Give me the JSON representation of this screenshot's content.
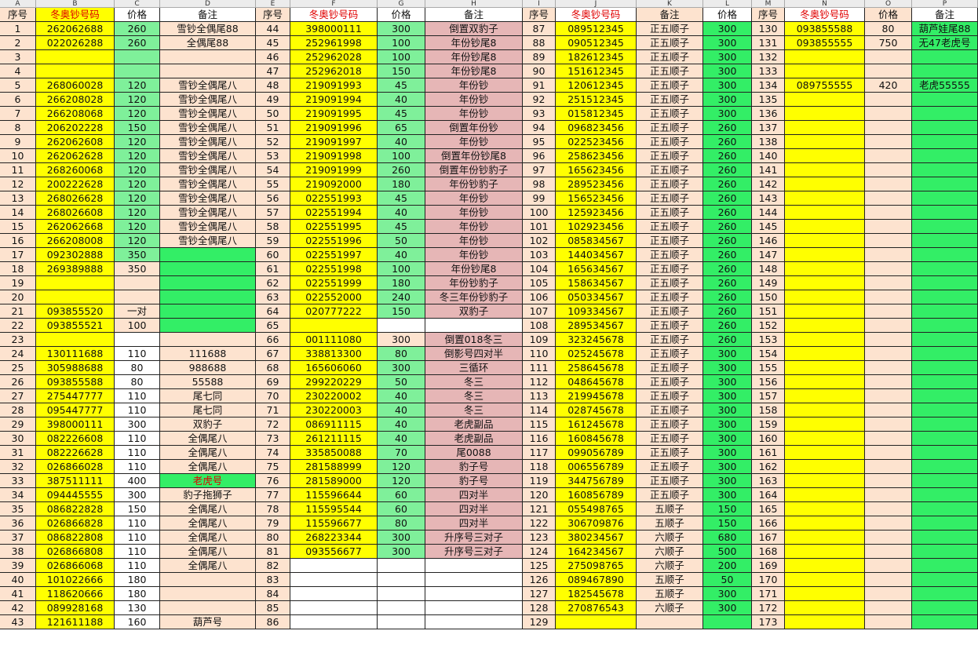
{
  "colors": {
    "yellow": "#ffff00",
    "pink": "#fde3cf",
    "green": "#33ee66",
    "green2": "#7ff09a",
    "rose": "#e6b6b6",
    "white": "#ffffff",
    "header_bg": "#ececec",
    "red_text": "#e00000"
  },
  "col_letters": [
    "A",
    "B",
    "C",
    "D",
    "E",
    "F",
    "G",
    "H",
    "I",
    "J",
    "K",
    "L",
    "M",
    "N",
    "O",
    "P"
  ],
  "header_row": [
    "序号",
    "冬奥钞号码",
    "价格",
    "备注",
    "序号",
    "冬奥钞号码",
    "价格",
    "备注",
    "序号",
    "冬奥钞号码",
    "备注",
    "价格",
    "序号",
    "冬奥钞号码",
    "价格",
    "备注"
  ],
  "rows": [
    [
      "1",
      "262062688",
      "260",
      "雪钞全偶尾88",
      "44",
      "398000111",
      "300",
      "倒置双豹子",
      "87",
      "089512345",
      "正五顺子",
      "300",
      "130",
      "093855588",
      "80",
      "葫芦娃尾88"
    ],
    [
      "2",
      "022026288",
      "260",
      "全偶尾88",
      "45",
      "252961998",
      "100",
      "年份钞尾8",
      "88",
      "090512345",
      "正五顺子",
      "300",
      "131",
      "093855555",
      "750",
      "无47老虎号"
    ],
    [
      "3",
      "",
      "",
      "",
      "46",
      "252962028",
      "100",
      "年份钞尾8",
      "89",
      "182612345",
      "正五顺子",
      "300",
      "132",
      "",
      "",
      ""
    ],
    [
      "4",
      "",
      "",
      "",
      "47",
      "252962018",
      "150",
      "年份钞尾8",
      "90",
      "151612345",
      "正五顺子",
      "300",
      "133",
      "",
      "",
      ""
    ],
    [
      "5",
      "268060028",
      "120",
      "雪钞全偶尾八",
      "48",
      "219091993",
      "45",
      "年份钞",
      "91",
      "120612345",
      "正五顺子",
      "300",
      "134",
      "089755555",
      "420",
      "老虎55555"
    ],
    [
      "6",
      "266208028",
      "120",
      "雪钞全偶尾八",
      "49",
      "219091994",
      "40",
      "年份钞",
      "92",
      "251512345",
      "正五顺子",
      "300",
      "135",
      "",
      "",
      ""
    ],
    [
      "7",
      "266208068",
      "120",
      "雪钞全偶尾八",
      "50",
      "219091995",
      "45",
      "年份钞",
      "93",
      "015812345",
      "正五顺子",
      "300",
      "136",
      "",
      "",
      ""
    ],
    [
      "8",
      "206202228",
      "150",
      "雪钞全偶尾八",
      "51",
      "219091996",
      "65",
      "倒置年份钞",
      "94",
      "096823456",
      "正五顺子",
      "260",
      "137",
      "",
      "",
      ""
    ],
    [
      "9",
      "262062608",
      "120",
      "雪钞全偶尾八",
      "52",
      "219091997",
      "40",
      "年份钞",
      "95",
      "022523456",
      "正五顺子",
      "260",
      "138",
      "",
      "",
      ""
    ],
    [
      "10",
      "262062628",
      "120",
      "雪钞全偶尾八",
      "53",
      "219091998",
      "100",
      "倒置年份钞尾8",
      "96",
      "258623456",
      "正五顺子",
      "260",
      "140",
      "",
      "",
      ""
    ],
    [
      "11",
      "268260068",
      "120",
      "雪钞全偶尾八",
      "54",
      "219091999",
      "260",
      "倒置年份钞豹子",
      "97",
      "165623456",
      "正五顺子",
      "260",
      "141",
      "",
      "",
      ""
    ],
    [
      "12",
      "200222628",
      "120",
      "雪钞全偶尾八",
      "55",
      "219092000",
      "180",
      "年份钞豹子",
      "98",
      "289523456",
      "正五顺子",
      "260",
      "142",
      "",
      "",
      ""
    ],
    [
      "13",
      "268026628",
      "120",
      "雪钞全偶尾八",
      "56",
      "022551993",
      "45",
      "年份钞",
      "99",
      "156523456",
      "正五顺子",
      "260",
      "143",
      "",
      "",
      ""
    ],
    [
      "14",
      "268026608",
      "120",
      "雪钞全偶尾八",
      "57",
      "022551994",
      "40",
      "年份钞",
      "100",
      "125923456",
      "正五顺子",
      "260",
      "144",
      "",
      "",
      ""
    ],
    [
      "15",
      "262062668",
      "120",
      "雪钞全偶尾八",
      "58",
      "022551995",
      "45",
      "年份钞",
      "101",
      "102923456",
      "正五顺子",
      "260",
      "145",
      "",
      "",
      ""
    ],
    [
      "16",
      "266208008",
      "120",
      "雪钞全偶尾八",
      "59",
      "022551996",
      "50",
      "年份钞",
      "102",
      "085834567",
      "正五顺子",
      "260",
      "146",
      "",
      "",
      ""
    ],
    [
      "17",
      "092302888",
      "350",
      "",
      "60",
      "022551997",
      "40",
      "年份钞",
      "103",
      "144034567",
      "正五顺子",
      "260",
      "147",
      "",
      "",
      ""
    ],
    [
      "18",
      "269389888",
      "350",
      "",
      "61",
      "022551998",
      "100",
      "年份钞尾8",
      "104",
      "165634567",
      "正五顺子",
      "260",
      "148",
      "",
      "",
      ""
    ],
    [
      "19",
      "",
      "",
      "",
      "62",
      "022551999",
      "180",
      "年份钞豹子",
      "105",
      "158634567",
      "正五顺子",
      "260",
      "149",
      "",
      "",
      ""
    ],
    [
      "20",
      "",
      "",
      "",
      "63",
      "022552000",
      "240",
      "冬三年份钞豹子",
      "106",
      "050334567",
      "正五顺子",
      "260",
      "150",
      "",
      "",
      ""
    ],
    [
      "21",
      "093855520",
      "一对",
      "",
      "64",
      "020777222",
      "150",
      "双豹子",
      "107",
      "109334567",
      "正五顺子",
      "260",
      "151",
      "",
      "",
      ""
    ],
    [
      "22",
      "093855521",
      "100",
      "",
      "65",
      "",
      "",
      "",
      "108",
      "289534567",
      "正五顺子",
      "260",
      "152",
      "",
      "",
      ""
    ],
    [
      "23",
      "",
      "",
      "",
      "66",
      "001111080",
      "300",
      "倒置018冬三",
      "109",
      "323245678",
      "正五顺子",
      "260",
      "153",
      "",
      "",
      ""
    ],
    [
      "24",
      "130111688",
      "110",
      "111688",
      "67",
      "338813300",
      "80",
      "倒影号四对半",
      "110",
      "025245678",
      "正五顺子",
      "300",
      "154",
      "",
      "",
      ""
    ],
    [
      "25",
      "305988688",
      "80",
      "988688",
      "68",
      "165606060",
      "300",
      "三循环",
      "111",
      "258645678",
      "正五顺子",
      "300",
      "155",
      "",
      "",
      ""
    ],
    [
      "26",
      "093855588",
      "80",
      "55588",
      "69",
      "299220229",
      "50",
      "冬三",
      "112",
      "048645678",
      "正五顺子",
      "300",
      "156",
      "",
      "",
      ""
    ],
    [
      "27",
      "275447777",
      "110",
      "尾七同",
      "70",
      "230220002",
      "40",
      "冬三",
      "113",
      "219945678",
      "正五顺子",
      "300",
      "157",
      "",
      "",
      ""
    ],
    [
      "28",
      "095447777",
      "110",
      "尾七同",
      "71",
      "230220003",
      "40",
      "冬三",
      "114",
      "028745678",
      "正五顺子",
      "300",
      "158",
      "",
      "",
      ""
    ],
    [
      "29",
      "398000111",
      "300",
      "双豹子",
      "72",
      "086911115",
      "40",
      "老虎副品",
      "115",
      "161245678",
      "正五顺子",
      "300",
      "159",
      "",
      "",
      ""
    ],
    [
      "30",
      "082226608",
      "110",
      "全偶尾八",
      "73",
      "261211115",
      "40",
      "老虎副品",
      "116",
      "160845678",
      "正五顺子",
      "300",
      "160",
      "",
      "",
      ""
    ],
    [
      "31",
      "082226628",
      "110",
      "全偶尾八",
      "74",
      "335850088",
      "70",
      "尾0088",
      "117",
      "099056789",
      "正五顺子",
      "300",
      "161",
      "",
      "",
      ""
    ],
    [
      "32",
      "026866028",
      "110",
      "全偶尾八",
      "75",
      "281588999",
      "120",
      "豹子号",
      "118",
      "006556789",
      "正五顺子",
      "300",
      "162",
      "",
      "",
      ""
    ],
    [
      "33",
      "387511111",
      "400",
      "老虎号",
      "76",
      "281589000",
      "120",
      "豹子号",
      "119",
      "344756789",
      "正五顺子",
      "300",
      "163",
      "",
      "",
      ""
    ],
    [
      "34",
      "094445555",
      "300",
      "豹子拖狮子",
      "77",
      "115596644",
      "60",
      "四对半",
      "120",
      "160856789",
      "正五顺子",
      "300",
      "164",
      "",
      "",
      ""
    ],
    [
      "35",
      "086822828",
      "150",
      "全偶尾八",
      "78",
      "115595544",
      "60",
      "四对半",
      "121",
      "055498765",
      "五顺子",
      "150",
      "165",
      "",
      "",
      ""
    ],
    [
      "36",
      "026866828",
      "110",
      "全偶尾八",
      "79",
      "115596677",
      "80",
      "四对半",
      "122",
      "306709876",
      "五顺子",
      "150",
      "166",
      "",
      "",
      ""
    ],
    [
      "37",
      "086822808",
      "110",
      "全偶尾八",
      "80",
      "268223344",
      "300",
      "升序号三对子",
      "123",
      "380234567",
      "六顺子",
      "680",
      "167",
      "",
      "",
      ""
    ],
    [
      "38",
      "026866808",
      "110",
      "全偶尾八",
      "81",
      "093556677",
      "300",
      "升序号三对子",
      "124",
      "164234567",
      "六顺子",
      "500",
      "168",
      "",
      "",
      ""
    ],
    [
      "39",
      "026866068",
      "110",
      "全偶尾八",
      "82",
      "",
      "",
      "",
      "125",
      "275098765",
      "六顺子",
      "200",
      "169",
      "",
      "",
      ""
    ],
    [
      "40",
      "101022666",
      "180",
      "",
      "83",
      "",
      "",
      "",
      "126",
      "089467890",
      "五顺子",
      "50",
      "170",
      "",
      "",
      ""
    ],
    [
      "41",
      "118620666",
      "180",
      "",
      "84",
      "",
      "",
      "",
      "127",
      "182545678",
      "五顺子",
      "300",
      "171",
      "",
      "",
      ""
    ],
    [
      "42",
      "089928168",
      "130",
      "",
      "85",
      "",
      "",
      "",
      "128",
      "270876543",
      "六顺子",
      "300",
      "172",
      "",
      "",
      ""
    ],
    [
      "43",
      "121611188",
      "160",
      "葫芦号",
      "86",
      "",
      "",
      "",
      "129",
      "",
      "",
      "",
      "173",
      "",
      "",
      ""
    ]
  ]
}
